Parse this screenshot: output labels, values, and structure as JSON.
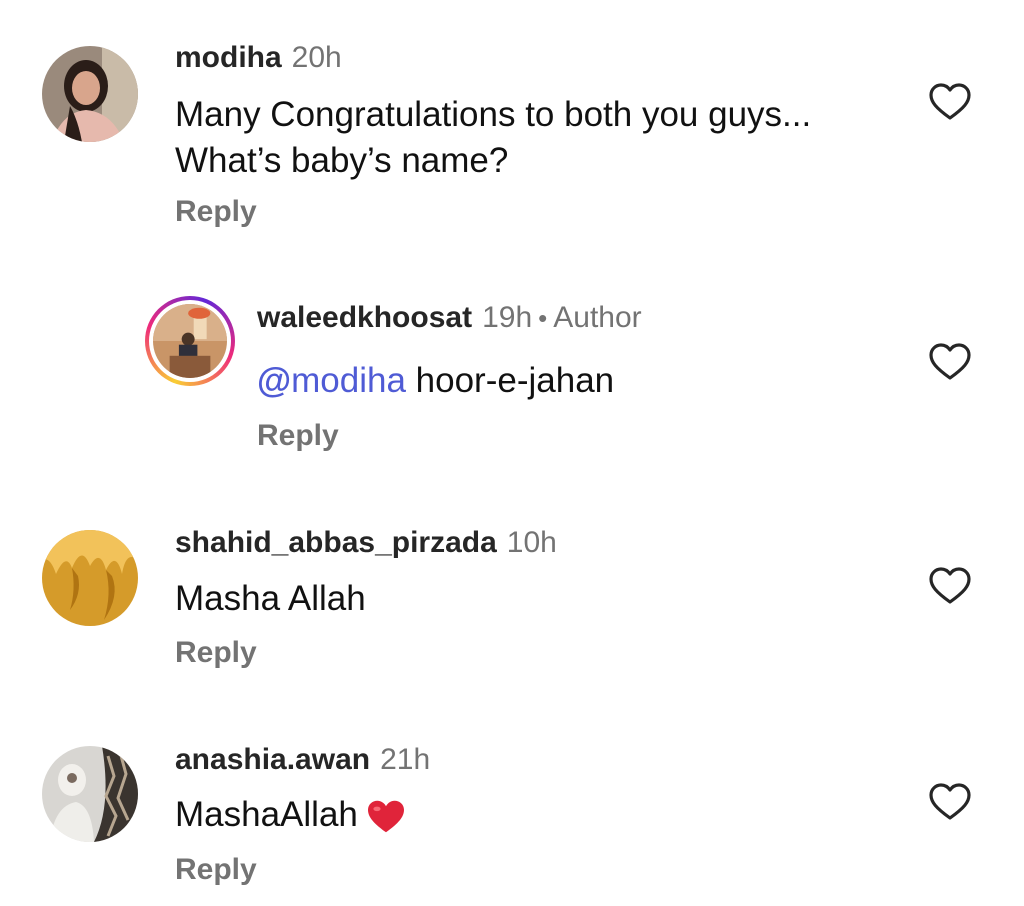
{
  "comments": [
    {
      "username": "modiha",
      "time": "20h",
      "lines": [
        "Many Congratulations to both you guys...",
        "What’s baby’s name?"
      ],
      "reply": "Reply"
    },
    {
      "username": "waleedkhoosat",
      "time": "19h",
      "dot": "•",
      "author_label": "Author",
      "mention_icon": "@",
      "mention": "modiha",
      "text": " hoor-e-jahan",
      "reply": "Reply"
    },
    {
      "username": "shahid_abbas_pirzada",
      "time": "10h",
      "text": "Masha Allah",
      "reply": "Reply"
    },
    {
      "username": "anashia.awan",
      "time": "21h",
      "text": "MashaAllah",
      "emoji": "red-heart-emoji",
      "reply": "Reply"
    }
  ],
  "colors": {
    "username": "#262626",
    "secondary": "#737373",
    "mention": "#4f5bd5",
    "heart_emoji": "#e0243a"
  },
  "icons": {
    "like": "heart-outline-icon"
  }
}
